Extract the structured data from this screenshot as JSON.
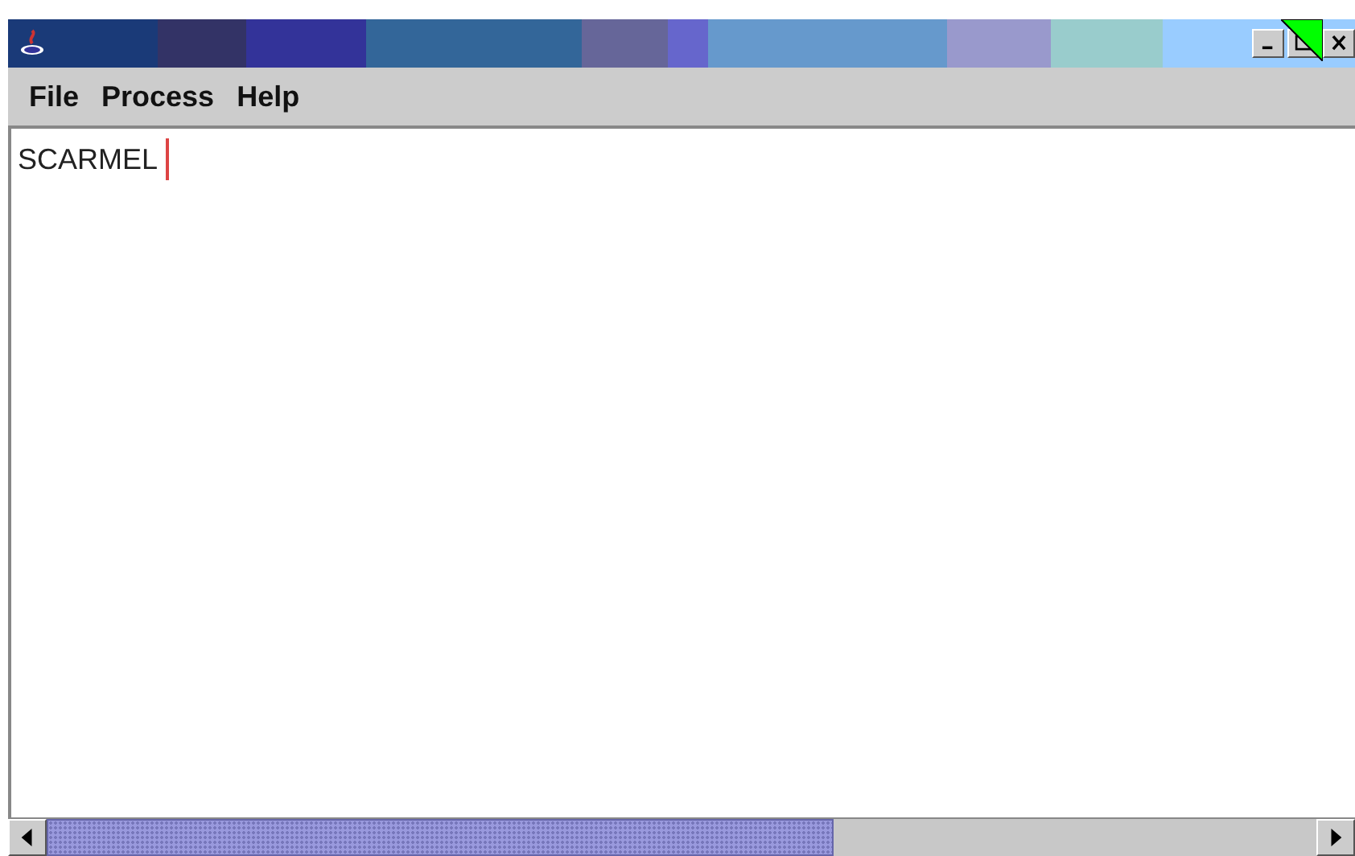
{
  "menu_bar": {
    "items": [
      {
        "label": "File"
      },
      {
        "label": "Process"
      },
      {
        "label": "Help"
      }
    ]
  },
  "editor": {
    "value": "SCARMEL",
    "focused": true
  }
}
